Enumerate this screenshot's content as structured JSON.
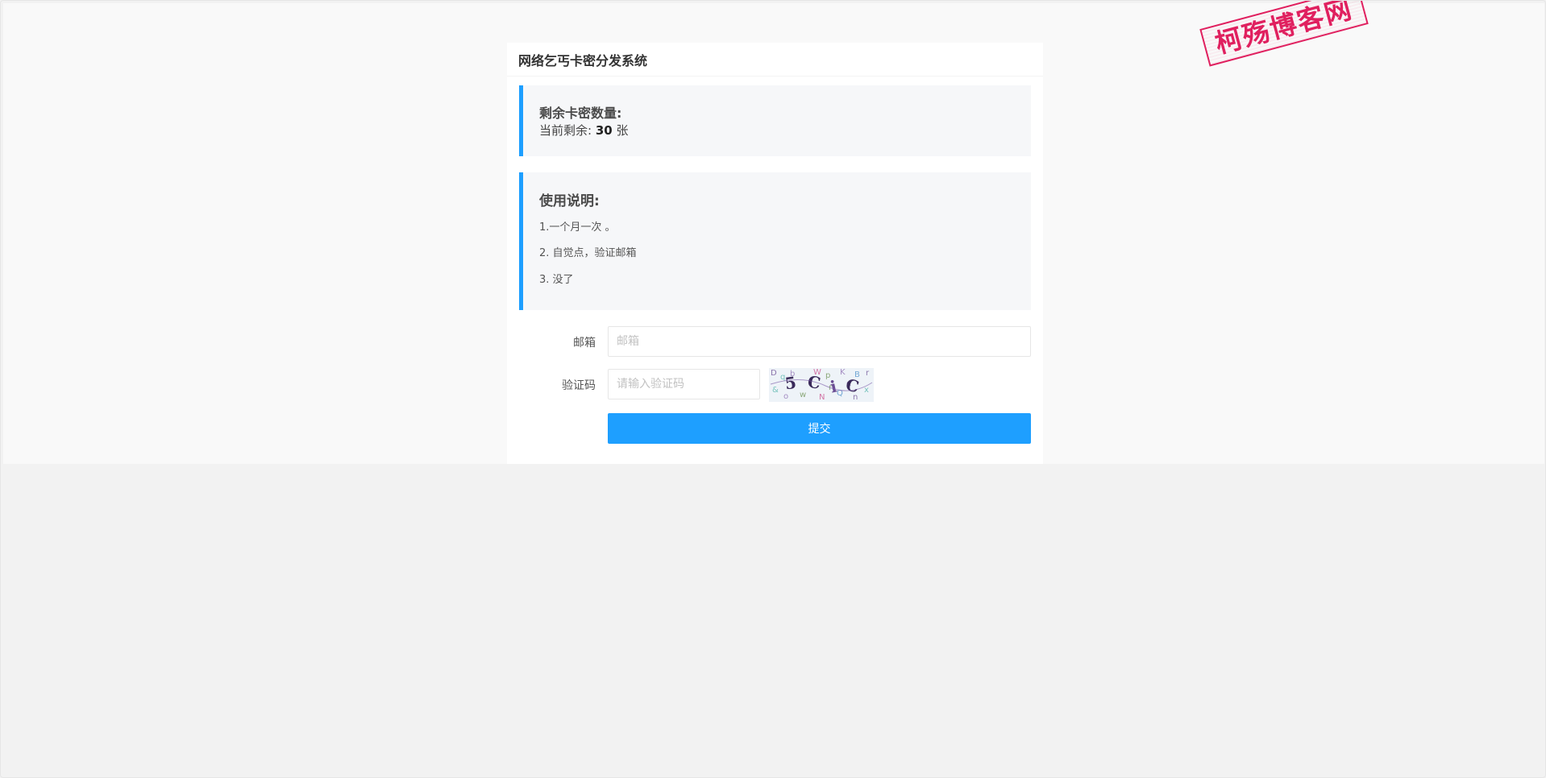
{
  "card": {
    "title": "网络乞丐卡密分发系统"
  },
  "stock": {
    "title": "剩余卡密数量:",
    "prefix": "当前剩余:",
    "count": "30",
    "unit": "张"
  },
  "usage": {
    "title": "使用说明:",
    "items": [
      "1.一个月一次 。",
      "2. 自觉点，验证邮箱",
      "3. 没了"
    ]
  },
  "form": {
    "email_label": "邮箱",
    "email_placeholder": "邮箱",
    "email_value": "",
    "captcha_label": "验证码",
    "captcha_placeholder": "请输入验证码",
    "captcha_value": "",
    "captcha_text": "5CiC",
    "submit_label": "提交"
  },
  "watermark": {
    "text": "柯殇博客网",
    "color": "#e0205f"
  },
  "colors": {
    "accent": "#1e9fff",
    "quote_bg": "#f6f7f9",
    "page_bg": "#f2f2f2"
  }
}
